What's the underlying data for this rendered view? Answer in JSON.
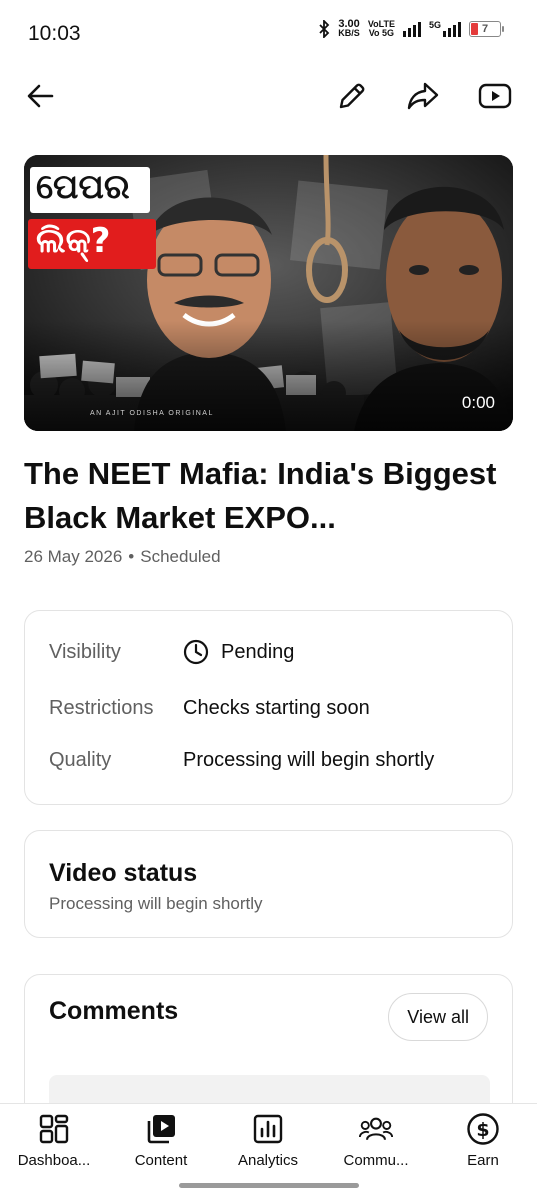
{
  "status_bar": {
    "time": "10:03",
    "speed_value": "3.00",
    "speed_unit": "KB/S",
    "volte_top": "VoLTE",
    "volte_bottom": "Vo 5G",
    "network": "5G",
    "battery_level": "7",
    "battery_color": "#e43b3b"
  },
  "top_bar": {
    "back_icon": "arrow-left-icon",
    "edit_icon": "pencil-icon",
    "share_icon": "share-icon",
    "watch_icon": "youtube-play-icon"
  },
  "video": {
    "thumbnail_text_line1": "ପେପର",
    "thumbnail_text_line2": "ଲିକ୍?",
    "thumbnail_tag": "AN AJIT ODISHA ORIGINAL",
    "duration": "0:00",
    "title": "The NEET Mafia: India's Biggest Black Market EXPO...",
    "date": "26 May 2026",
    "separator": "•",
    "state": "Scheduled"
  },
  "details": {
    "visibility_label": "Visibility",
    "visibility_value": "Pending",
    "visibility_icon": "clock-icon",
    "restrictions_label": "Restrictions",
    "restrictions_value": "Checks starting soon",
    "quality_label": "Quality",
    "quality_value": "Processing will begin shortly"
  },
  "video_status": {
    "title": "Video status",
    "subtitle": "Processing will begin shortly"
  },
  "comments": {
    "title": "Comments",
    "view_all_label": "View all"
  },
  "bottom_nav": {
    "items": [
      {
        "label": "Dashboa...",
        "icon": "dashboard-icon"
      },
      {
        "label": "Content",
        "icon": "content-icon"
      },
      {
        "label": "Analytics",
        "icon": "analytics-icon"
      },
      {
        "label": "Commu...",
        "icon": "community-icon"
      },
      {
        "label": "Earn",
        "icon": "dollar-icon"
      }
    ]
  }
}
